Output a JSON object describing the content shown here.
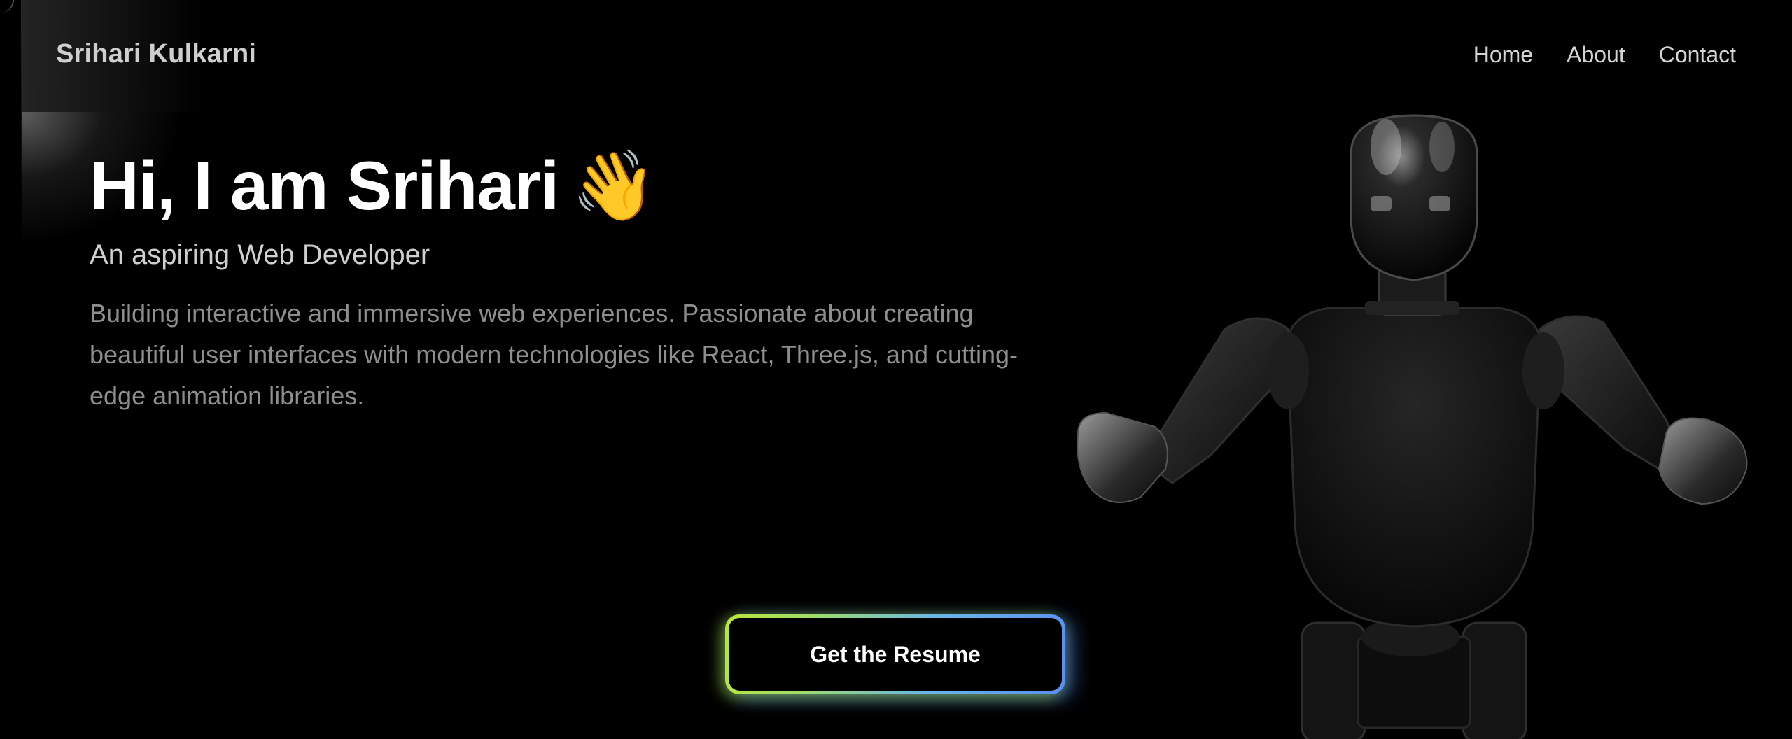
{
  "header": {
    "brand": "Srihari Kulkarni",
    "nav": [
      {
        "label": "Home"
      },
      {
        "label": "About"
      },
      {
        "label": "Contact"
      }
    ]
  },
  "hero": {
    "title": "Hi, I am Srihari",
    "wave_emoji": "👋",
    "subtitle": "An aspiring Web Developer",
    "description": "Building interactive and immersive web experiences. Passionate about creating beautiful user interfaces with modern technologies like React, Three.js, and cutting-edge animation libraries.",
    "cta_label": "Get the Resume"
  },
  "colors": {
    "background": "#000000",
    "cta_gradient_start": "#b9e63a",
    "cta_gradient_end": "#5a8ff0",
    "title": "#ffffff",
    "description": "#8e8e8e"
  },
  "icons": {
    "wave": "waving-hand-icon",
    "hero_image": "robot-illustration"
  }
}
